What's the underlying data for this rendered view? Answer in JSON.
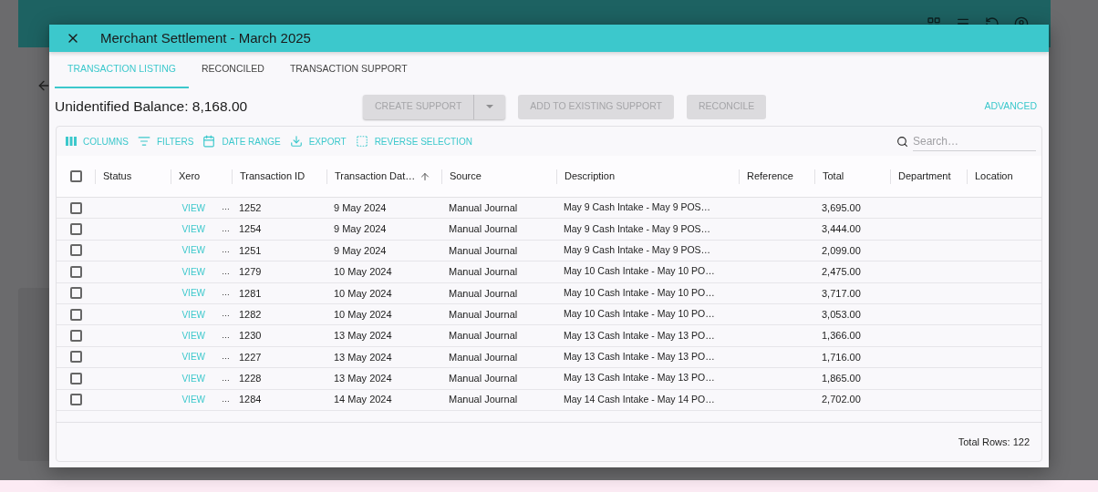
{
  "dialog": {
    "title": "Merchant Settlement - March 2025"
  },
  "tabs": [
    {
      "label": "TRANSACTION LISTING",
      "selected": true
    },
    {
      "label": "RECONCILED",
      "selected": false
    },
    {
      "label": "TRANSACTION SUPPORT",
      "selected": false
    }
  ],
  "balance": "Unidentified Balance: 8,168.00",
  "actions": [
    {
      "label": "CREATE SUPPORT",
      "kind": "split",
      "disabled": true
    },
    {
      "label": "ADD TO EXISTING SUPPORT",
      "kind": "button",
      "disabled": true
    },
    {
      "label": "RECONCILE",
      "kind": "button",
      "disabled": true
    }
  ],
  "advanced": "ADVANCED",
  "toolbar": [
    {
      "label": "COLUMNS",
      "kind": "columns"
    },
    {
      "label": "FILTERS",
      "kind": "filters"
    },
    {
      "label": "DATE RANGE",
      "kind": "date"
    },
    {
      "label": "EXPORT",
      "kind": "export"
    },
    {
      "label": "REVERSE SELECTION",
      "kind": "reverse"
    }
  ],
  "search": {
    "placeholder": "Search…"
  },
  "table": {
    "select_all": {
      "checked": false
    },
    "columns": [
      {
        "label": "Status",
        "sorted": false
      },
      {
        "label": "Xero",
        "sorted": false
      },
      {
        "label": "Transaction ID",
        "sorted": false
      },
      {
        "label": "Transaction Dat…",
        "sorted": true
      },
      {
        "label": "Source",
        "sorted": false
      },
      {
        "label": "Description",
        "sorted": false
      },
      {
        "label": "Reference",
        "sorted": false
      },
      {
        "label": "Total",
        "sorted": false
      },
      {
        "label": "Department",
        "sorted": false
      },
      {
        "label": "Location",
        "sorted": false
      }
    ],
    "rows": [
      {
        "checked": false,
        "xero": "VIEW",
        "xero_more": "…",
        "id": "1252",
        "date": "9 May 2024",
        "source": "Manual Journal",
        "description": "May 9 Cash Intake - May 9 POS…",
        "total": "3,695.00"
      },
      {
        "checked": false,
        "xero": "VIEW",
        "xero_more": "…",
        "id": "1254",
        "date": "9 May 2024",
        "source": "Manual Journal",
        "description": "May 9 Cash Intake - May 9 POS…",
        "total": "3,444.00"
      },
      {
        "checked": false,
        "xero": "VIEW",
        "xero_more": "…",
        "id": "1251",
        "date": "9 May 2024",
        "source": "Manual Journal",
        "description": "May 9 Cash Intake - May 9 POS…",
        "total": "2,099.00"
      },
      {
        "checked": false,
        "xero": "VIEW",
        "xero_more": "…",
        "id": "1279",
        "date": "10 May 2024",
        "source": "Manual Journal",
        "description": "May 10 Cash Intake - May 10 PO…",
        "total": "2,475.00"
      },
      {
        "checked": false,
        "xero": "VIEW",
        "xero_more": "…",
        "id": "1281",
        "date": "10 May 2024",
        "source": "Manual Journal",
        "description": "May 10 Cash Intake - May 10 PO…",
        "total": "3,717.00"
      },
      {
        "checked": false,
        "xero": "VIEW",
        "xero_more": "…",
        "id": "1282",
        "date": "10 May 2024",
        "source": "Manual Journal",
        "description": "May 10 Cash Intake - May 10 PO…",
        "total": "3,053.00"
      },
      {
        "checked": false,
        "xero": "VIEW",
        "xero_more": "…",
        "id": "1230",
        "date": "13 May 2024",
        "source": "Manual Journal",
        "description": "May 13 Cash Intake - May 13 PO…",
        "total": "1,366.00"
      },
      {
        "checked": false,
        "xero": "VIEW",
        "xero_more": "…",
        "id": "1227",
        "date": "13 May 2024",
        "source": "Manual Journal",
        "description": "May 13 Cash Intake - May 13 PO…",
        "total": "1,716.00"
      },
      {
        "checked": false,
        "xero": "VIEW",
        "xero_more": "…",
        "id": "1228",
        "date": "13 May 2024",
        "source": "Manual Journal",
        "description": "May 13 Cash Intake - May 13 PO…",
        "total": "1,865.00"
      },
      {
        "checked": false,
        "xero": "VIEW",
        "xero_more": "…",
        "id": "1284",
        "date": "14 May 2024",
        "source": "Manual Journal",
        "description": "May 14 Cash Intake - May 14 PO…",
        "total": "2,702.00"
      }
    ]
  },
  "total_rows": "Total Rows: 122"
}
